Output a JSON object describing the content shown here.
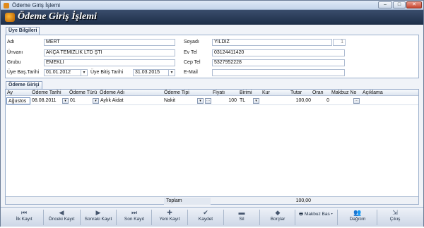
{
  "window": {
    "title": "Ödeme Giriş İşlemi",
    "min": "–",
    "max": "□",
    "close": "✕"
  },
  "header": {
    "title": "Ödeme Giriş İşlemi"
  },
  "member_tab": "Üye Bilgileri",
  "member": {
    "adi_label": "Adı",
    "adi": "MERT",
    "soyadi_label": "Soyadı",
    "soyadi": "YILDIZ",
    "soyadi_extra": "1",
    "unvani_label": "Ünvanı",
    "unvani": "AKÇA TEMİZLİK LTD ŞTİ",
    "evtel_label": "Ev Tel",
    "evtel": "03124411420",
    "grubu_label": "Grubu",
    "grubu": "EMEKLİ",
    "ceptel_label": "Cep Tel",
    "ceptel": "5327952228",
    "bas_label": "Üye Baş.Tarihi",
    "bas": "01.01.2012",
    "bitis_label": "Üye Bitiş Tarihi",
    "bitis": "31.03.2015",
    "email_label": "E-Mail",
    "email": ""
  },
  "payment_tab": "Ödeme Girişi",
  "grid": {
    "headers": [
      "Ay",
      "Ödeme Tarihi",
      "Ödeme Türü",
      "Ödeme Adı",
      "Ödeme Tipi",
      "Fiyatı",
      "Birimi",
      "Kur",
      "Tutar",
      "Oran",
      "Makbuz No",
      "Açıklama"
    ],
    "row": {
      "ay": "Ağustos",
      "tarih": "08.08.2011",
      "tur": "01",
      "adi": "Aylık Aidat",
      "tip": "Nakit",
      "fiyat": "100",
      "birim": "TL",
      "kur": "",
      "tutar": "100,00",
      "oran": "0",
      "makbuz": "",
      "aciklama": ""
    },
    "footer_label": "Toplam",
    "footer_total": "100,00"
  },
  "toolbar": {
    "ilk": "İlk Kayıt",
    "onceki": "Önceki Kayıt",
    "sonraki": "Sonraki Kayıt",
    "son": "Son Kayıt",
    "yeni": "Yeni Kayıt",
    "kaydet": "Kaydet",
    "sil": "Sil",
    "borclar": "Borçlar",
    "makbuz": "Makbuz Bas",
    "dagitim": "Dağıtım",
    "cikis": "Çıkış"
  },
  "colors": {
    "header_bg": "#1d2e48",
    "accent": "#e08a1a"
  }
}
